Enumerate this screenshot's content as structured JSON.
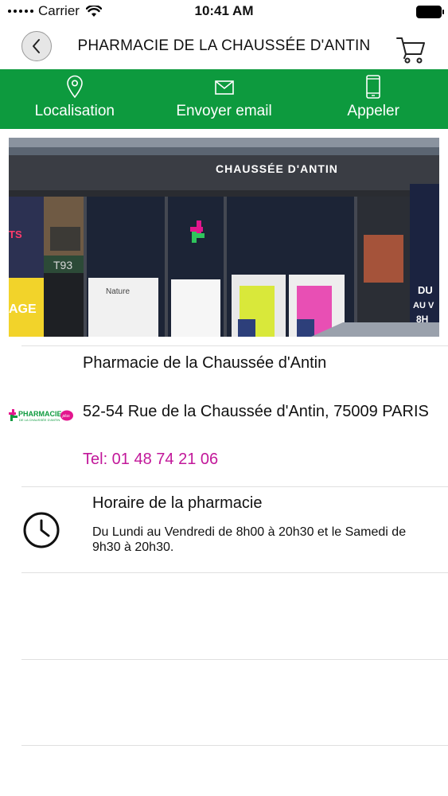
{
  "status_bar": {
    "carrier": "Carrier",
    "time": "10:41 AM"
  },
  "nav": {
    "title": "PHARMACIE DE LA CHAUSSÉE D'ANTIN",
    "back_icon": "chevron-left-icon",
    "cart_icon": "cart-icon"
  },
  "actions": [
    {
      "label": "Localisation",
      "icon": "location-pin-icon"
    },
    {
      "label": "Envoyer email",
      "icon": "envelope-icon"
    },
    {
      "label": "Appeler",
      "icon": "phone-icon"
    }
  ],
  "storefront": {
    "sign": "CHAUSSÉE D'ANTIN"
  },
  "pharmacy": {
    "name": "Pharmacie de la Chaussée d'Antin",
    "address": "52-54 Rue de la Chaussée d'Antin, 75009 PARIS",
    "phone": "Tel: 01 48 74 21 06",
    "logo_text": "PHARMACIE",
    "logo_sub": "DE LA CHAUSSÉE D'ANTIN",
    "logo_badge": "plus"
  },
  "hours": {
    "title": "Horaire de la pharmacie",
    "text": "Du Lundi au Vendredi de 8h00 à 20h30 et le Samedi de 9h30 à 20h30."
  },
  "colors": {
    "action_bar": "#0d9a3e",
    "phone_text": "#c2189a",
    "logo_green": "#0d9a3e",
    "logo_pink": "#e3168e"
  }
}
